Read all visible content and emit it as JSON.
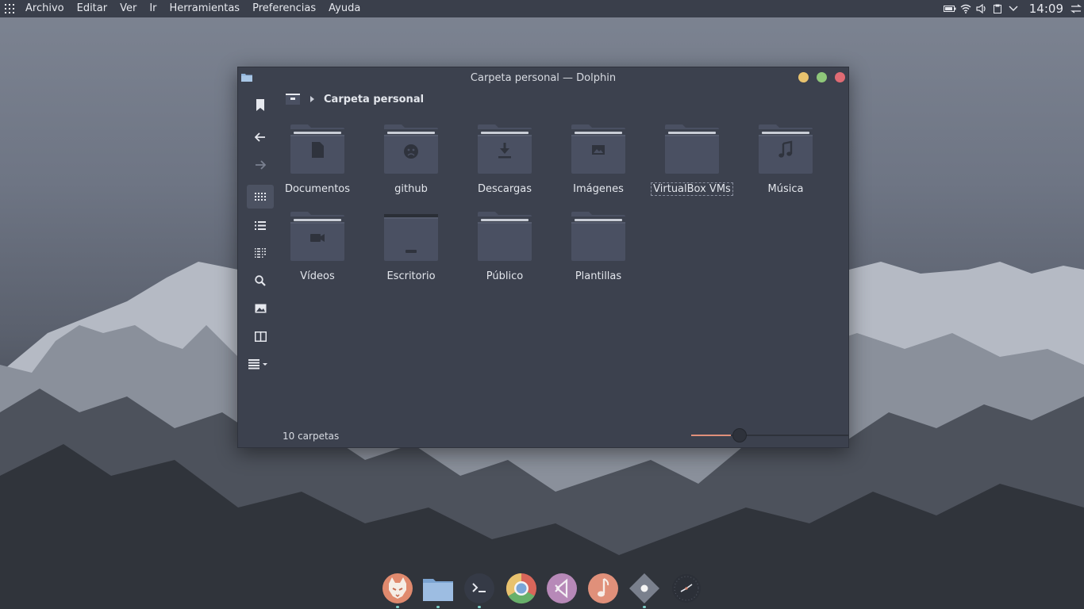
{
  "top_panel": {
    "menu": [
      "Archivo",
      "Editar",
      "Ver",
      "Ir",
      "Herramientas",
      "Preferencias",
      "Ayuda"
    ],
    "clock": "14:09"
  },
  "window": {
    "title": "Carpeta personal — Dolphin",
    "breadcrumb": "Carpeta personal",
    "folders": [
      {
        "name": "Documentos",
        "icon": "document-icon"
      },
      {
        "name": "github",
        "icon": "github-icon"
      },
      {
        "name": "Descargas",
        "icon": "download-icon"
      },
      {
        "name": "Imágenes",
        "icon": "image-icon"
      },
      {
        "name": "VirtualBox VMs",
        "icon": "folder-icon",
        "selected": true
      },
      {
        "name": "Música",
        "icon": "music-icon"
      },
      {
        "name": "Vídeos",
        "icon": "video-icon"
      },
      {
        "name": "Escritorio",
        "icon": "desktop-icon"
      },
      {
        "name": "Público",
        "icon": "folder-icon"
      },
      {
        "name": "Plantillas",
        "icon": "folder-icon"
      }
    ],
    "status": "10 carpetas",
    "zoom_level": 0.3
  },
  "dock": {
    "apps": [
      "firefox-icon",
      "files-icon",
      "terminal-icon",
      "chrome-icon",
      "vscode-icon",
      "music-player-icon",
      "settings-icon",
      "clock-icon"
    ]
  },
  "colors": {
    "panel": "#3a3f4b",
    "window_bg": "#3c414e",
    "folder_body": "#4a5062",
    "accent": "#e0907a"
  }
}
